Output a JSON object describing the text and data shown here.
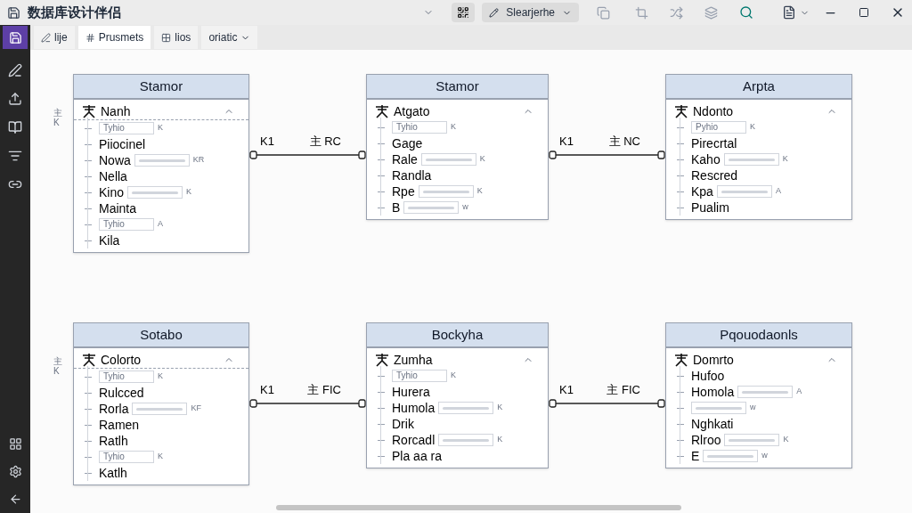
{
  "window": {
    "title": "数据库设计伴侣"
  },
  "toolbar": {
    "dropdown": "Slearjerhe"
  },
  "tabs": [
    {
      "label": "lije",
      "selected": false
    },
    {
      "label": "Prusmets",
      "selected": true
    },
    {
      "label": "lios",
      "selected": false
    },
    {
      "label": "oriatic",
      "selected": false,
      "kind": "menu"
    }
  ],
  "diagram": {
    "rows": [
      {
        "side_note": "主K",
        "entities": [
          {
            "title": "Stamor",
            "dashed_divider": true,
            "fields": [
              {
                "kind": "key",
                "label": "Nanh"
              },
              {
                "kind": "field",
                "label": "Tyhio",
                "note": "K"
              },
              {
                "kind": "column",
                "label": "Piiocinel"
              },
              {
                "kind": "column-field",
                "label": "Nowa",
                "note": "KR"
              },
              {
                "kind": "column",
                "label": "Nella"
              },
              {
                "kind": "column-field",
                "label": "Kino",
                "note": "K"
              },
              {
                "kind": "column",
                "label": "Mainta"
              },
              {
                "kind": "field",
                "label": "Tyhio",
                "note": "A"
              },
              {
                "kind": "column",
                "label": "Kila"
              }
            ]
          },
          {
            "title": "Stamor",
            "dashed_divider": false,
            "fields": [
              {
                "kind": "key",
                "label": "Atgato"
              },
              {
                "kind": "field",
                "label": "Tyhio",
                "note": "K"
              },
              {
                "kind": "column",
                "label": "Gage"
              },
              {
                "kind": "column-field",
                "label": "Rale",
                "note": "K"
              },
              {
                "kind": "column",
                "label": "Randla"
              },
              {
                "kind": "column-field",
                "label": "Rpe",
                "note": "K"
              },
              {
                "kind": "column-field",
                "label": "B",
                "note": "w"
              }
            ]
          },
          {
            "title": "Arpta",
            "dashed_divider": false,
            "fields": [
              {
                "kind": "key",
                "label": "Ndonto"
              },
              {
                "kind": "field",
                "label": "Pyhio",
                "note": "K"
              },
              {
                "kind": "column",
                "label": "Pirecrtal"
              },
              {
                "kind": "column-field",
                "label": "Kaho",
                "note": "K"
              },
              {
                "kind": "column",
                "label": "Rescred"
              },
              {
                "kind": "column-field",
                "label": "Kpa",
                "note": "A"
              },
              {
                "kind": "column",
                "label": "Pualim"
              }
            ]
          }
        ],
        "links": [
          {
            "from_label": "K1",
            "to_label": "主 RC"
          },
          {
            "from_label": "K1",
            "to_label": "主 NC"
          }
        ]
      },
      {
        "side_note": "主K",
        "entities": [
          {
            "title": "Sotabo",
            "dashed_divider": true,
            "fields": [
              {
                "kind": "key",
                "label": "Colorto"
              },
              {
                "kind": "field",
                "label": "Tyhio",
                "note": "K"
              },
              {
                "kind": "column",
                "label": "Rulcced"
              },
              {
                "kind": "column-field",
                "label": "Rorla",
                "note": "KF"
              },
              {
                "kind": "column",
                "label": "Ramen"
              },
              {
                "kind": "column",
                "label": "Ratlh"
              },
              {
                "kind": "field",
                "label": "Tyhio",
                "note": "K"
              },
              {
                "kind": "column",
                "label": "Katlh"
              }
            ]
          },
          {
            "title": "Bockyha",
            "dashed_divider": false,
            "fields": [
              {
                "kind": "key",
                "label": "Zumha"
              },
              {
                "kind": "field",
                "label": "Tyhio",
                "note": "K"
              },
              {
                "kind": "column",
                "label": "Hurera"
              },
              {
                "kind": "column-field",
                "label": "Humola",
                "note": "K"
              },
              {
                "kind": "column",
                "label": "Drik"
              },
              {
                "kind": "column-field",
                "label": "Rorcadl",
                "note": "K"
              },
              {
                "kind": "column",
                "label": "Pla aa ra"
              }
            ]
          },
          {
            "title": "Pqouodaonls",
            "dashed_divider": false,
            "fields": [
              {
                "kind": "key",
                "label": "Domrto"
              },
              {
                "kind": "column",
                "label": "Hufoo"
              },
              {
                "kind": "column-field",
                "label": "Homola",
                "note": "A"
              },
              {
                "kind": "blank-field",
                "note": "w"
              },
              {
                "kind": "column",
                "label": "Nghkati"
              },
              {
                "kind": "column-field",
                "label": "Rlroo",
                "note": "K"
              },
              {
                "kind": "column-field",
                "label": "E",
                "note": "w"
              }
            ]
          }
        ],
        "links": [
          {
            "from_label": "K1",
            "to_label": "主 FIC"
          },
          {
            "from_label": "K1",
            "to_label": "主 FIC"
          }
        ]
      }
    ]
  }
}
